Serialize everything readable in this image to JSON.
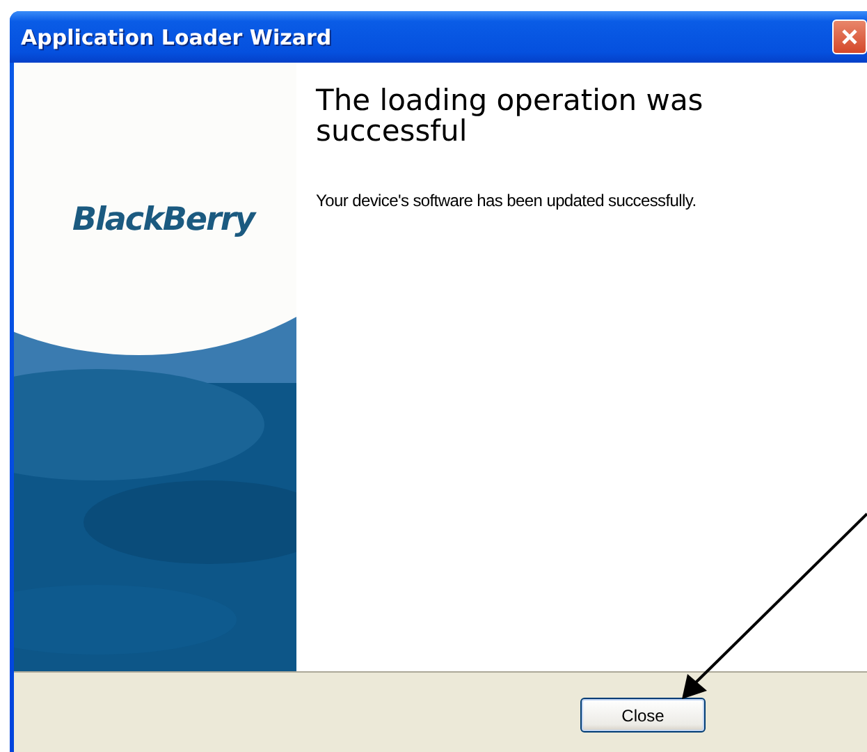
{
  "window": {
    "title": "Application Loader Wizard"
  },
  "banner": {
    "logo": "BlackBerry",
    "kind": "picture"
  },
  "heading": "The loading operation was successful",
  "message": "Your device's software has been updated successfully.",
  "buttons": [
    {
      "label": "Close"
    }
  ],
  "annotation": {
    "kind": "arrow"
  }
}
